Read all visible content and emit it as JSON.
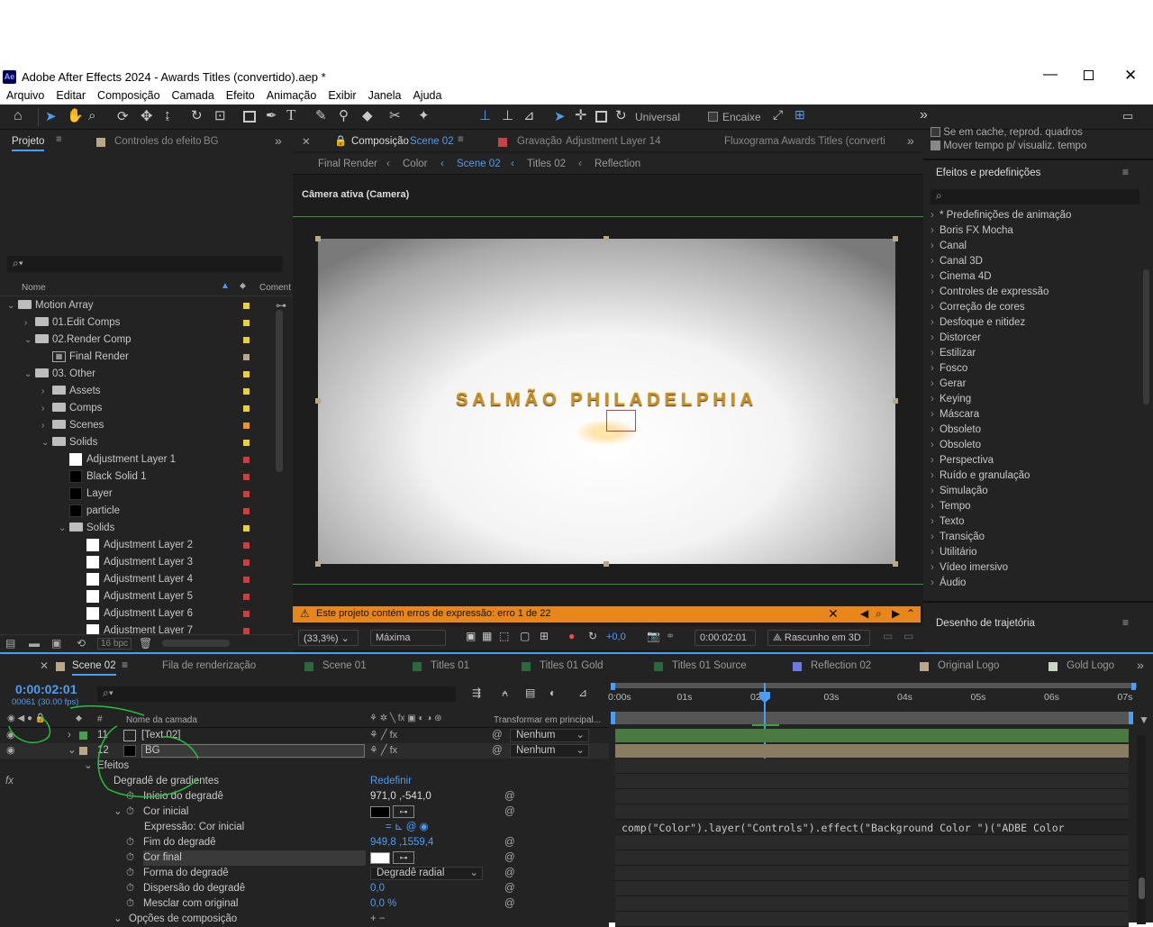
{
  "window": {
    "title": "Adobe After Effects 2024 - Awards Titles (convertido).aep *",
    "app_icon": "Ae"
  },
  "menu": [
    "Arquivo",
    "Editar",
    "Composição",
    "Camada",
    "Efeito",
    "Animação",
    "Exibir",
    "Janela",
    "Ajuda"
  ],
  "toolbar": {
    "universal": "Universal",
    "encaixe": "Encaixe"
  },
  "project_panel": {
    "tab_project": "Projeto",
    "tab_effects_controls": "Controles do efeito",
    "effects_controls_target": "BG",
    "col_name": "Nome",
    "col_comment": "Coment",
    "items": [
      {
        "label": "Motion Array",
        "type": "folder",
        "indent": 0,
        "twirl": "open",
        "color": "#e8d040"
      },
      {
        "label": "01.Edit Comps",
        "type": "folder",
        "indent": 1,
        "twirl": "closed",
        "color": "#e8d040"
      },
      {
        "label": "02.Render Comp",
        "type": "folder",
        "indent": 1,
        "twirl": "open",
        "color": "#e8d040"
      },
      {
        "label": "Final Render",
        "type": "comp",
        "indent": 2,
        "twirl": "none",
        "color": "#b8a888"
      },
      {
        "label": "03. Other",
        "type": "folder",
        "indent": 1,
        "twirl": "open",
        "color": "#e8d040"
      },
      {
        "label": "Assets",
        "type": "folder",
        "indent": 2,
        "twirl": "closed",
        "color": "#e8d040"
      },
      {
        "label": "Comps",
        "type": "folder",
        "indent": 2,
        "twirl": "closed",
        "color": "#e8d040"
      },
      {
        "label": "Scenes",
        "type": "folder",
        "indent": 2,
        "twirl": "closed",
        "color": "#e8952a"
      },
      {
        "label": "Solids",
        "type": "folder",
        "indent": 2,
        "twirl": "open",
        "color": "#e8d040"
      },
      {
        "label": "Adjustment Layer 1",
        "type": "white",
        "indent": 3,
        "twirl": "none",
        "color": "#c84040"
      },
      {
        "label": "Black Solid 1",
        "type": "black",
        "indent": 3,
        "twirl": "none",
        "color": "#c84040"
      },
      {
        "label": "Layer",
        "type": "black",
        "indent": 3,
        "twirl": "none",
        "color": "#c84040"
      },
      {
        "label": "particle",
        "type": "black",
        "indent": 3,
        "twirl": "none",
        "color": "#c84040"
      },
      {
        "label": "Solids",
        "type": "folder",
        "indent": 3,
        "twirl": "open",
        "color": "#e8d040"
      },
      {
        "label": "Adjustment Layer 2",
        "type": "white",
        "indent": 4,
        "twirl": "none",
        "color": "#c84040"
      },
      {
        "label": "Adjustment Layer 3",
        "type": "white",
        "indent": 4,
        "twirl": "none",
        "color": "#c84040"
      },
      {
        "label": "Adjustment Layer 4",
        "type": "white",
        "indent": 4,
        "twirl": "none",
        "color": "#c84040"
      },
      {
        "label": "Adjustment Layer 5",
        "type": "white",
        "indent": 4,
        "twirl": "none",
        "color": "#c84040"
      },
      {
        "label": "Adjustment Layer 6",
        "type": "white",
        "indent": 4,
        "twirl": "none",
        "color": "#c84040"
      },
      {
        "label": "Adjustment Layer 7",
        "type": "white",
        "indent": 4,
        "twirl": "none",
        "color": "#c84040"
      }
    ],
    "bpc": "16 bpc"
  },
  "comp_panel": {
    "tab_label": "Composição",
    "tab_comp": "Scene 02",
    "tab_recording": "Gravação",
    "tab_recording_target": "Adjustment Layer 14",
    "tab_flowchart": "Fluxograma Awards Titles (converti",
    "breadcrumbs": [
      "Final Render",
      "Color",
      "Scene 02",
      "Titles 02",
      "Reflection"
    ],
    "active_camera": "Câmera ativa (Camera)",
    "canvas_text": "SALMÃO PHILADELPHIA",
    "warning": "Este projeto contém erros de expressão: erro 1 de 22",
    "zoom": "(33,3%)",
    "quality": "Máxima",
    "exposure": "+0,0",
    "timecode": "0:00:02:01",
    "renderer": "Rascunho em 3D"
  },
  "right_panel": {
    "cb1": "Se em cache, reprod. quadros",
    "cb2": "Mover tempo p/ visualiz. tempo",
    "effects_title": "Efeitos e predefinições",
    "effects": [
      "* Predefinições de animação",
      "Boris FX Mocha",
      "Canal",
      "Canal 3D",
      "Cinema 4D",
      "Controles de expressão",
      "Correção de cores",
      "Desfoque e nitidez",
      "Distorcer",
      "Estilizar",
      "Fosco",
      "Gerar",
      "Keying",
      "Máscara",
      "Obsoleto",
      "Obsoleto",
      "Perspectiva",
      "Ruído e granulação",
      "Simulação",
      "Tempo",
      "Texto",
      "Transição",
      "Utilitário",
      "Vídeo imersivo",
      "Áudio"
    ],
    "motion_sketch": "Desenho de trajetória"
  },
  "timeline": {
    "tabs": [
      {
        "label": "Scene 02",
        "color": "#b8a888",
        "active": true
      },
      {
        "label": "Fila de renderização",
        "color": "",
        "active": false
      },
      {
        "label": "Scene 01",
        "color": "#2a6a3a",
        "active": false
      },
      {
        "label": "Titles 01",
        "color": "#2a6a3a",
        "active": false
      },
      {
        "label": "Titles 01 Gold",
        "color": "#2a6a3a",
        "active": false
      },
      {
        "label": "Titles 01 Source",
        "color": "#2a6a3a",
        "active": false
      },
      {
        "label": "Reflection 02",
        "color": "#6a7ae8",
        "active": false
      },
      {
        "label": "Original Logo",
        "color": "#b8a888",
        "active": false
      },
      {
        "label": "Gold Logo",
        "color": "#c8d8c0",
        "active": false
      }
    ],
    "timecode": "0:00:02:01",
    "frames": "00061 (30.00 fps)",
    "col_layer_name": "Nome da camada",
    "col_transform": "Transformar em principal...",
    "ruler": [
      "0:00s",
      "01s",
      "02s",
      "03s",
      "04s",
      "05s",
      "06s",
      "07s"
    ],
    "layers": [
      {
        "num": "11",
        "name": "[Text 02]",
        "parent": "Nenhum",
        "color": "#4aa050"
      },
      {
        "num": "12",
        "name": "BG",
        "parent": "Nenhum",
        "color": "#b8a888"
      }
    ],
    "props": [
      {
        "label": "Efeitos",
        "value": "",
        "indent": 0
      },
      {
        "label": "Degradê de gradientes",
        "value": "Redefinir",
        "indent": 1
      },
      {
        "label": "Início do degradê",
        "value": "971,0 ,-541,0",
        "indent": 2
      },
      {
        "label": "Cor inicial",
        "value": "",
        "indent": 2
      },
      {
        "label": "Expressão: Cor inicial",
        "value": "",
        "indent": 3
      },
      {
        "label": "Fim do degradê",
        "value": "949,8 ,1559,4",
        "indent": 2
      },
      {
        "label": "Cor final",
        "value": "",
        "indent": 2
      },
      {
        "label": "Forma do degradê",
        "value": "Degradê radial",
        "indent": 2
      },
      {
        "label": "Dispersão do degradê",
        "value": "0,0",
        "indent": 2
      },
      {
        "label": "Mesclar com original",
        "value": "0,0 %",
        "indent": 2
      },
      {
        "label": "Opções de composição",
        "value": "",
        "indent": 1
      }
    ],
    "expression": "comp(\"Color\").layer(\"Controls\").effect(\"Background Color \")(\"ADBE Color"
  }
}
